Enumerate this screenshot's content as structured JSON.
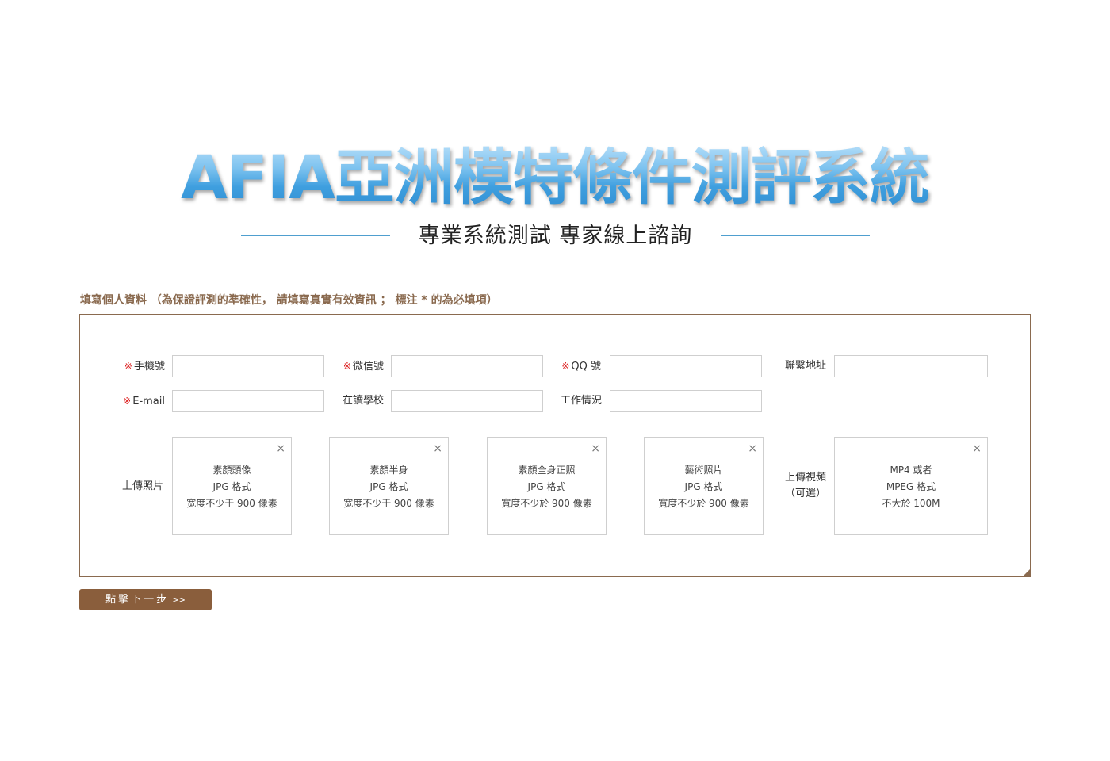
{
  "header": {
    "title": "AFIA亞洲模特條件測評系統",
    "tagline": "專業系統測試  專家線上諮詢"
  },
  "form": {
    "section_title": "填寫個人資料 （為保證評測的準確性， 請填寫真實有效資訊 ； 標注 * 的為必填項）",
    "required_mark": "※",
    "fields": {
      "mobile": {
        "label": "手機號",
        "value": "",
        "required": true
      },
      "wechat": {
        "label": "微信號",
        "value": "",
        "required": true
      },
      "qq": {
        "label": "QQ 號",
        "value": "",
        "required": true
      },
      "address": {
        "label": "聯繫地址",
        "value": "",
        "required": false
      },
      "email": {
        "label": "E-mail",
        "value": "",
        "required": true
      },
      "school": {
        "label": "在讀學校",
        "value": "",
        "required": false
      },
      "work": {
        "label": "工作情況",
        "value": "",
        "required": false
      }
    },
    "photo_upload": {
      "label": "上傳照片",
      "close_symbol": "×",
      "slots": [
        {
          "title": "素顏頭像",
          "format": "JPG 格式",
          "size_note": "宽度不少于 900 像素"
        },
        {
          "title": "素顏半身",
          "format": "JPG 格式",
          "size_note": "宽度不少于 900 像素"
        },
        {
          "title": "素顏全身正照",
          "format": "JPG 格式",
          "size_note": "寬度不少於 900 像素"
        },
        {
          "title": "藝術照片",
          "format": "JPG 格式",
          "size_note": "寬度不少於 900 像素"
        }
      ]
    },
    "video_upload": {
      "label_line1": "上傳視頻",
      "label_line2": "（可選）",
      "title": "MP4 或者",
      "format": "MPEG 格式",
      "size_note": "不大於 100M"
    },
    "next_button": {
      "label": "點擊下一步",
      "chevron": ">>"
    }
  },
  "colors": {
    "title_blue": "#4ba6e0",
    "accent_brown": "#8a6a4f",
    "button_brown": "#8a5e3c",
    "required_red": "#dd2222"
  }
}
